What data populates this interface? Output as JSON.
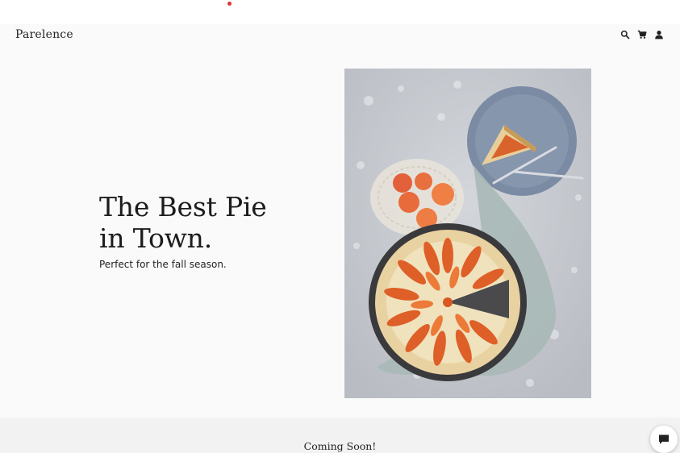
{
  "header": {
    "logo": "Parelence",
    "icons": [
      "search-icon",
      "cart-icon",
      "user-icon"
    ]
  },
  "hero": {
    "title_line1": "The Best Pie",
    "title_line2": "in Town.",
    "subtitle": "Perfect for the fall season.",
    "image_subject": "apricot tart photo"
  },
  "footer": {
    "coming_soon": "Coming Soon!"
  },
  "chat": {
    "icon": "chat-icon"
  },
  "colors": {
    "page_background": "#fafafa",
    "footer_band": "#f2f2f2",
    "text": "#1c1c1c",
    "indicator_dot": "#e03030"
  }
}
